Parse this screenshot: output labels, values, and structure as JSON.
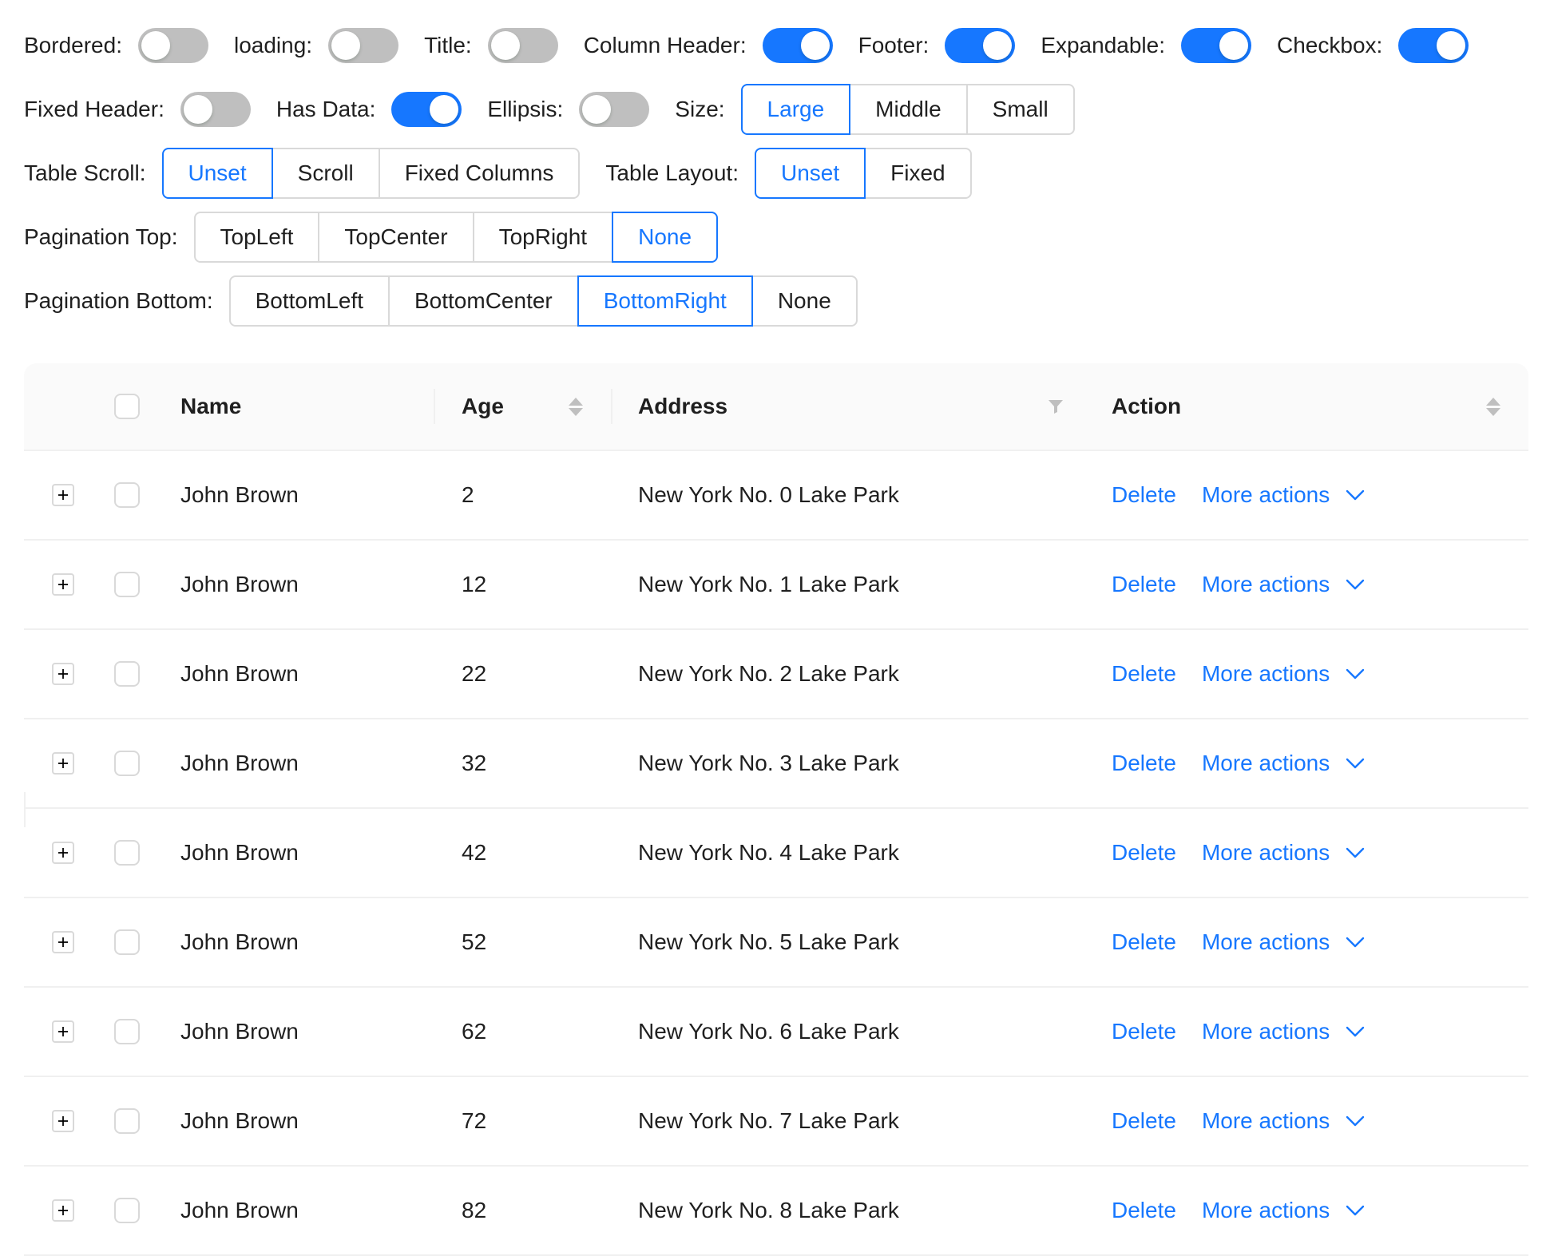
{
  "controls": {
    "bordered": {
      "label": "Bordered",
      "on": false
    },
    "loading": {
      "label": "loading",
      "on": false
    },
    "title": {
      "label": "Title",
      "on": false
    },
    "column_header": {
      "label": "Column Header",
      "on": true
    },
    "footer": {
      "label": "Footer",
      "on": true
    },
    "expandable": {
      "label": "Expandable",
      "on": true
    },
    "checkbox": {
      "label": "Checkbox",
      "on": true
    },
    "fixed_header": {
      "label": "Fixed Header",
      "on": false
    },
    "has_data": {
      "label": "Has Data",
      "on": true
    },
    "ellipsis": {
      "label": "Ellipsis",
      "on": false
    },
    "size": {
      "label": "Size",
      "options": [
        "Large",
        "Middle",
        "Small"
      ],
      "selected": "Large"
    },
    "table_scroll": {
      "label": "Table Scroll",
      "options": [
        "Unset",
        "Scroll",
        "Fixed Columns"
      ],
      "selected": "Unset"
    },
    "table_layout": {
      "label": "Table Layout",
      "options": [
        "Unset",
        "Fixed"
      ],
      "selected": "Unset"
    },
    "pagination_top": {
      "label": "Pagination Top",
      "options": [
        "TopLeft",
        "TopCenter",
        "TopRight",
        "None"
      ],
      "selected": "None"
    },
    "pagination_bottom": {
      "label": "Pagination Bottom",
      "options": [
        "BottomLeft",
        "BottomCenter",
        "BottomRight",
        "None"
      ],
      "selected": "BottomRight"
    }
  },
  "table": {
    "columns": {
      "name": "Name",
      "age": "Age",
      "address": "Address",
      "action": "Action"
    },
    "action_labels": {
      "delete": "Delete",
      "more": "More actions"
    },
    "rows": [
      {
        "name": "John Brown",
        "age": "2",
        "address": "New York No. 0 Lake Park"
      },
      {
        "name": "John Brown",
        "age": "12",
        "address": "New York No. 1 Lake Park"
      },
      {
        "name": "John Brown",
        "age": "22",
        "address": "New York No. 2 Lake Park"
      },
      {
        "name": "John Brown",
        "age": "32",
        "address": "New York No. 3 Lake Park"
      },
      {
        "name": "John Brown",
        "age": "42",
        "address": "New York No. 4 Lake Park"
      },
      {
        "name": "John Brown",
        "age": "52",
        "address": "New York No. 5 Lake Park"
      },
      {
        "name": "John Brown",
        "age": "62",
        "address": "New York No. 6 Lake Park"
      },
      {
        "name": "John Brown",
        "age": "72",
        "address": "New York No. 7 Lake Park"
      },
      {
        "name": "John Brown",
        "age": "82",
        "address": "New York No. 8 Lake Park"
      }
    ]
  },
  "colors": {
    "primary": "#1677ff",
    "switch_off": "#bfbfbf",
    "border": "#d9d9d9"
  }
}
